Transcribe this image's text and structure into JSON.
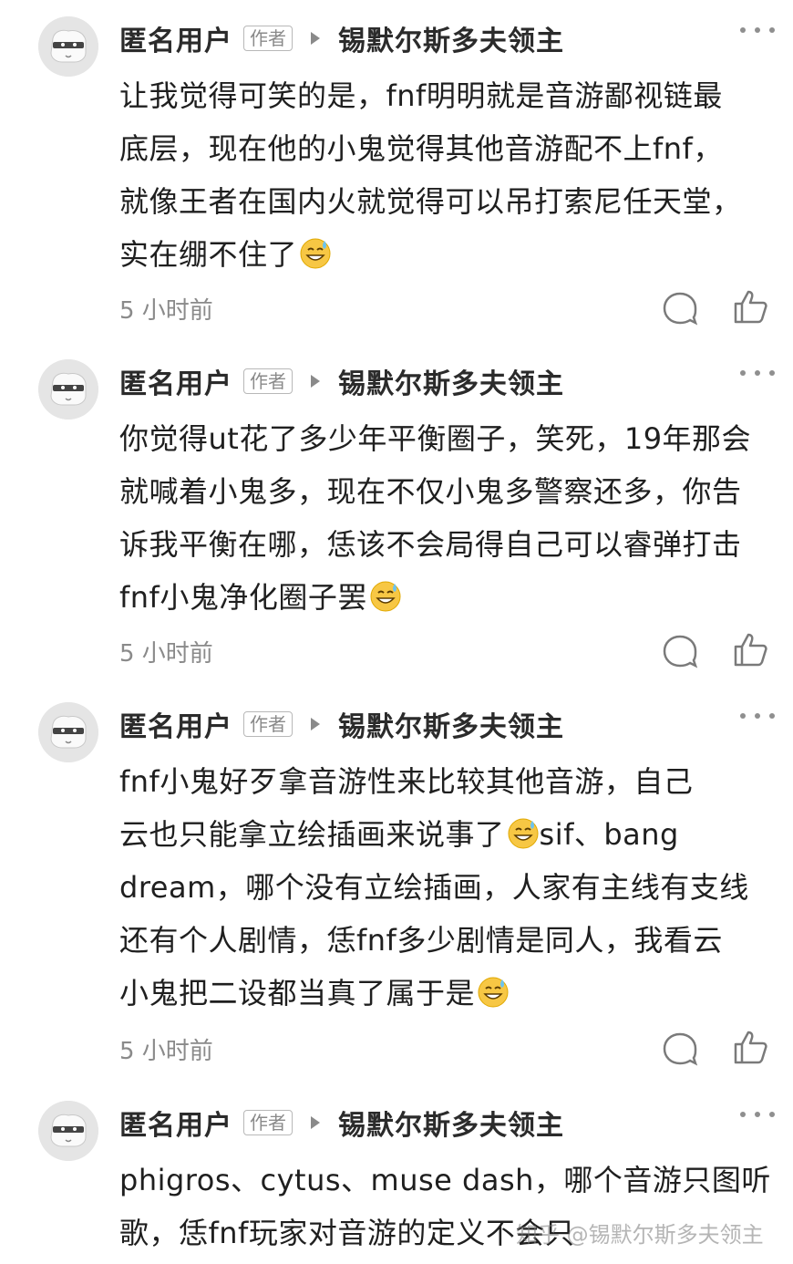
{
  "comments": [
    {
      "author": "匿名用户",
      "badge": "作者",
      "reply_to": "锡默尔斯多夫领主",
      "lines": [
        "让我觉得可笑的是，fnf明明就是音游鄙视链最",
        "底层，现在他的小鬼觉得其他音游配不上fnf，",
        "就像王者在国内火就觉得可以吊打索尼任天堂，",
        "实在绷不住了"
      ],
      "time": "5 小时前"
    },
    {
      "author": "匿名用户",
      "badge": "作者",
      "reply_to": "锡默尔斯多夫领主",
      "lines": [
        "你觉得ut花了多少年平衡圈子，笑死，19年那会",
        "就喊着小鬼多，现在不仅小鬼多警察还多，你告",
        "诉我平衡在哪，恁该不会局得自己可以睿弹打击",
        "fnf小鬼净化圈子罢"
      ],
      "time": "5 小时前"
    },
    {
      "author": "匿名用户",
      "badge": "作者",
      "reply_to": "锡默尔斯多夫领主",
      "lines": [
        "fnf小鬼好歹拿音游性来比较其他音游，自己",
        "云也只能拿立绘插画来说事了",
        "sif、bang",
        "dream，哪个没有立绘插画，人家有主线有支线",
        "还有个人剧情，恁fnf多少剧情是同人，我看云",
        "小鬼把二设都当真了属于是"
      ],
      "time": "5 小时前"
    },
    {
      "author": "匿名用户",
      "badge": "作者",
      "reply_to": "锡默尔斯多夫领主",
      "lines": [
        "phigros、cytus、muse dash，哪个音游只图听",
        "歌，恁fnf玩家对音游的定义不会只"
      ]
    }
  ],
  "icons": {
    "emoji": "sweat-smile-icon",
    "reply": "comment-bubble-icon",
    "like": "thumbs-up-icon",
    "more": "more-dots-icon"
  },
  "watermark": "知乎 @锡默尔斯多夫领主"
}
